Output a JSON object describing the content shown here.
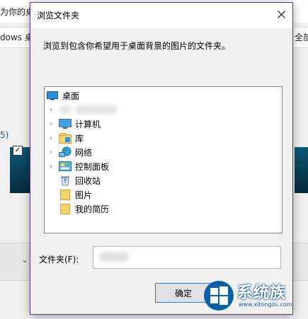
{
  "background": {
    "top_text": "为你的桌",
    "row_left_text": "dows 桌",
    "row_right_text": "全部",
    "side_text": "5)",
    "checkbox_mark": "✓",
    "dropdown_glyph": "⌄"
  },
  "dialog": {
    "title": "浏览文件夹",
    "instruction": "浏览到包含你希望用于桌面背景的图片的文件夹。",
    "tree": [
      {
        "label": "桌面",
        "icon": "desktop-icon",
        "expandable": false
      },
      {
        "label": "",
        "icon": "user-folder-icon",
        "expandable": true
      },
      {
        "label": "计算机",
        "icon": "computer-icon",
        "expandable": true
      },
      {
        "label": "库",
        "icon": "library-icon",
        "expandable": true
      },
      {
        "label": "网络",
        "icon": "network-icon",
        "expandable": true
      },
      {
        "label": "控制面板",
        "icon": "control-panel-icon",
        "expandable": true
      },
      {
        "label": "回收站",
        "icon": "recycle-bin-icon",
        "expandable": false
      },
      {
        "label": "图片",
        "icon": "folder-icon",
        "expandable": false
      },
      {
        "label": "我的简历",
        "icon": "folder-icon",
        "expandable": false
      }
    ],
    "folder_label": "文件夹(F):",
    "folder_value": "",
    "ok_label": "确定"
  },
  "watermark": {
    "title": "系统族",
    "subtitle": "www.xitongzu.com"
  },
  "colors": {
    "dialog_border": "#5e3a8c",
    "button_focus": "#2a7ad6",
    "folder_yellow": "#f3d36b"
  }
}
